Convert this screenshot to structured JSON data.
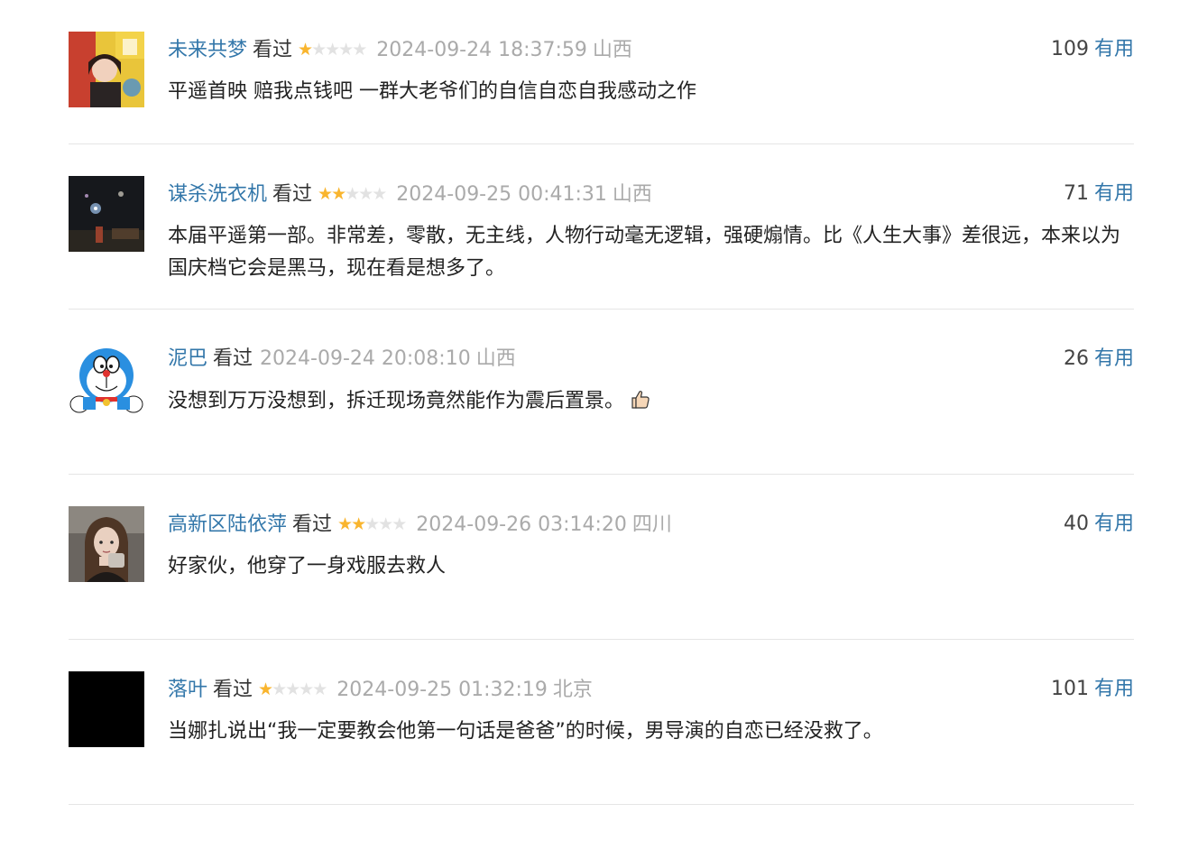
{
  "labels": {
    "watched": "看过",
    "useful": "有用"
  },
  "colors": {
    "username": "#3377aa",
    "star_on": "#f9b52e",
    "star_off": "#e2e2e2",
    "meta_gray": "#aaaaaa",
    "divider": "#e5e5e5"
  },
  "comments": [
    {
      "user": "未来共梦",
      "rating": 1,
      "time": "2024-09-24 18:37:59",
      "location": "山西",
      "votes": "109",
      "content": "平遥首映 赔我点钱吧 一群大老爷们的自信自恋自我感动之作",
      "avatar": "photo-girl-yellow-background"
    },
    {
      "user": "谋杀洗衣机",
      "rating": 2,
      "time": "2024-09-25 00:41:31",
      "location": "山西",
      "votes": "71",
      "content": "本届平遥第一部。非常差，零散，无主线，人物行动毫无逻辑，强硬煽情。比《人生大事》差很远，本来以为国庆档它会是黑马，现在看是想多了。",
      "avatar": "photo-fireworks-night"
    },
    {
      "user": "泥巴",
      "rating": 0,
      "time": "2024-09-24 20:08:10",
      "location": "山西",
      "votes": "26",
      "content": "没想到万万没想到，拆迁现场竟然能作为震后置景。",
      "avatar": "doraemon-cartoon",
      "trailing_icon": "thumbs-up-icon"
    },
    {
      "user": "高新区陆依萍",
      "rating": 2,
      "time": "2024-09-26 03:14:20",
      "location": "四川",
      "votes": "40",
      "content": "好家伙，他穿了一身戏服去救人",
      "avatar": "photo-woman-portrait"
    },
    {
      "user": "落叶",
      "rating": 1,
      "time": "2024-09-25 01:32:19",
      "location": "北京",
      "votes": "101",
      "content": "当娜扎说出“我一定要教会他第一句话是爸爸”的时候，男导演的自恋已经没救了。",
      "avatar": "black-square"
    }
  ]
}
